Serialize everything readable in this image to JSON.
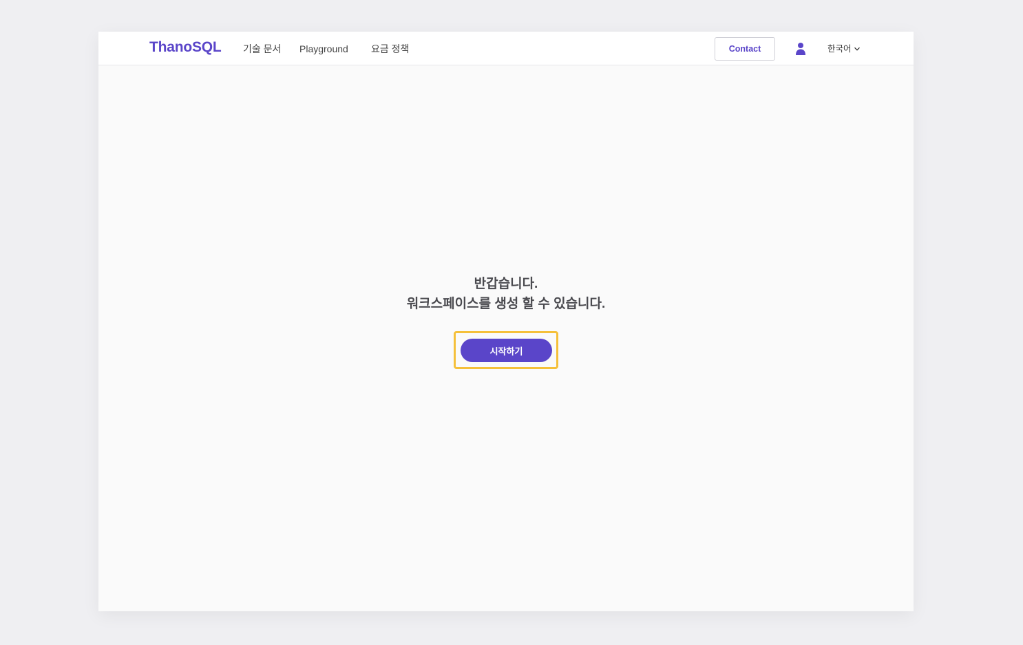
{
  "header": {
    "logo": "ThanoSQL",
    "nav": {
      "docs": "기술 문서",
      "playground": "Playground",
      "pricing": "요금 정책"
    },
    "contact_label": "Contact",
    "user_icon": "user-icon",
    "language": "한국어",
    "language_icon": "chevron-down-icon"
  },
  "main": {
    "greeting_line1": "반갑습니다.",
    "greeting_line2": "워크스페이스를 생성 할 수 있습니다.",
    "start_label": "시작하기"
  },
  "colors": {
    "brand": "#5a45c9",
    "highlight": "#f5c03a",
    "background": "#efeff2",
    "content_background": "#fafafa"
  }
}
